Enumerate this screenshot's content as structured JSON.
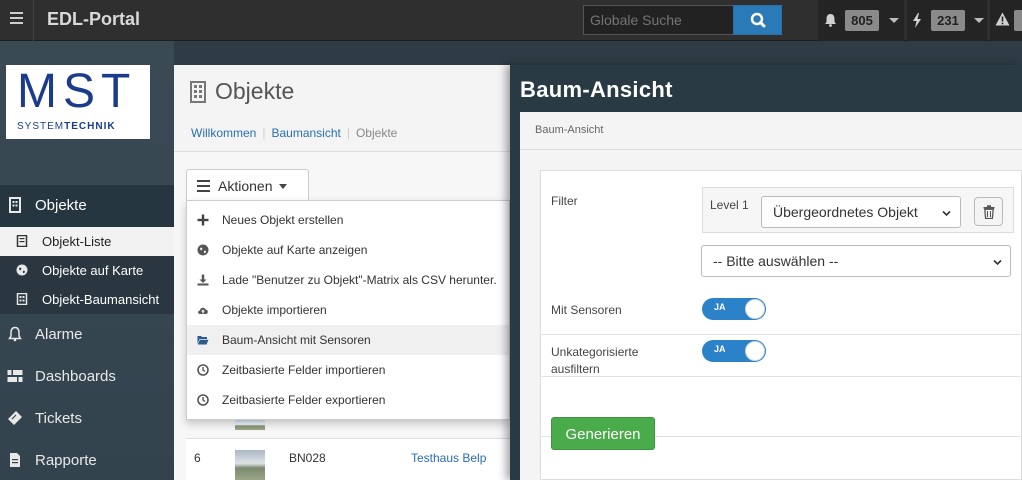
{
  "topbar": {
    "app_title": "EDL-Portal",
    "search_placeholder": "Globale Suche",
    "notifications_count": "805",
    "events_count": "231",
    "colors": {
      "background": "#2f2f2f",
      "search_button": "#2a7ab8"
    }
  },
  "sidebar": {
    "logo": {
      "main": "MST",
      "sub_left": "SYSTEM",
      "sub_right": "TECHNIK"
    },
    "items": [
      {
        "label": "Objekte",
        "icon": "building-icon",
        "active": true
      },
      {
        "label": "Alarme",
        "icon": "bell-icon"
      },
      {
        "label": "Dashboards",
        "icon": "dashboard-icon"
      },
      {
        "label": "Tickets",
        "icon": "ticket-icon"
      },
      {
        "label": "Rapporte",
        "icon": "report-icon"
      }
    ],
    "subitems": [
      {
        "label": "Objekt-Liste",
        "icon": "list-icon",
        "selected": true
      },
      {
        "label": "Objekte auf Karte",
        "icon": "globe-icon"
      },
      {
        "label": "Objekt-Baumansicht",
        "icon": "tree-icon"
      }
    ]
  },
  "objekte_panel": {
    "title": "Objekte",
    "breadcrumbs": [
      "Willkommen",
      "Baumansicht",
      "Objekte"
    ],
    "actions_label": "Aktionen",
    "menu": [
      {
        "label": "Neues Objekt erstellen",
        "icon": "plus-icon"
      },
      {
        "label": "Objekte auf Karte anzeigen",
        "icon": "globe-icon"
      },
      {
        "label": "Lade \"Benutzer zu Objekt\"-Matrix als CSV herunter.",
        "icon": "download-icon"
      },
      {
        "label": "Objekte importieren",
        "icon": "cloud-upload-icon"
      },
      {
        "label": "Baum-Ansicht mit Sensoren",
        "icon": "folder-open-icon",
        "highlighted": true
      },
      {
        "label": "Zeitbasierte Felder importieren",
        "icon": "clock-icon"
      },
      {
        "label": "Zeitbasierte Felder exportieren",
        "icon": "clock-icon"
      }
    ],
    "row": {
      "number": "6",
      "code": "BN028",
      "name": "Testhaus Belp"
    }
  },
  "baum_ansicht": {
    "title": "Baum-Ansicht",
    "card_title": "Baum-Ansicht",
    "filter_label": "Filter",
    "level_label": "Level 1",
    "parent_select": "Übergeordnetes Objekt",
    "choose_select": "-- Bitte auswählen --",
    "sensors_label": "Mit Sensoren",
    "sensors_toggle": "JA",
    "uncategorized_label_1": "Unkategorisierte",
    "uncategorized_label_2": "ausfiltern",
    "uncategorized_toggle": "JA",
    "generate_label": "Generieren"
  }
}
